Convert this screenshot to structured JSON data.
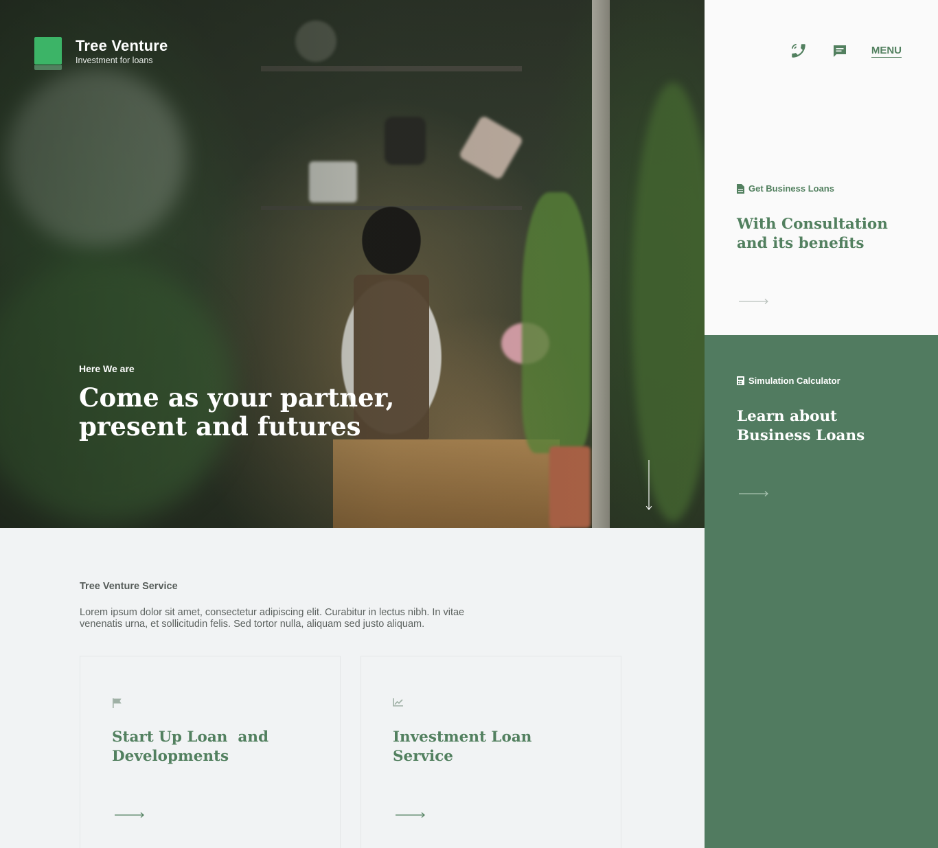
{
  "brand": {
    "name": "Tree Venture",
    "tagline": "Investment for loans"
  },
  "nav": {
    "phone_icon": "phone-icon",
    "chat_icon": "chat-icon",
    "menu_label": "MENU"
  },
  "hero": {
    "eyebrow": "Here We are",
    "title_line1": "Come as your partner,",
    "title_line2": "present and futures"
  },
  "side_cards": [
    {
      "icon": "document-icon",
      "eyebrow": "Get Business Loans",
      "title_line1": "With Consultation",
      "title_line2": "and its benefits"
    },
    {
      "icon": "calculator-icon",
      "eyebrow": "Simulation Calculator",
      "title_line1": "Learn about",
      "title_line2": "Business Loans"
    }
  ],
  "services": {
    "label": "Tree Venture Service",
    "description_line1": "Lorem ipsum dolor sit amet, consectetur adipiscing elit. Curabitur in lectus nibh. In vitae",
    "description_line2": "venenatis urna, et sollicitudin felis. Sed tortor nulla, aliquam sed justo aliquam.",
    "cards": [
      {
        "icon": "flag-icon",
        "title_line1": "Start Up Loan  and",
        "title_line2": "Developments"
      },
      {
        "icon": "chart-icon",
        "title_line1": "Investment Loan",
        "title_line2": "Service"
      }
    ]
  },
  "colors": {
    "brand_green": "#52805f",
    "logo_green": "#3cb467",
    "panel_green": "#517b60",
    "panel_light": "#fafafa",
    "page_bg": "#f1f3f4"
  }
}
